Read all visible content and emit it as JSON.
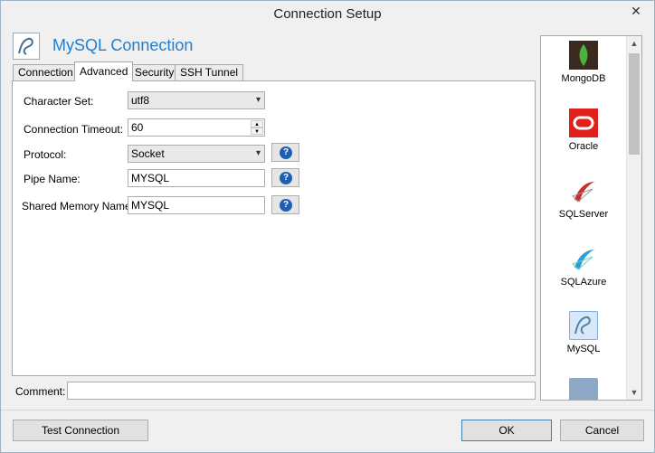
{
  "window": {
    "title": "Connection Setup",
    "close_glyph": "✕"
  },
  "header": {
    "title": "MySQL Connection",
    "logo_icon": "mysql-dolphin-icon"
  },
  "tabs": [
    {
      "label": "Connection",
      "active": false
    },
    {
      "label": "Advanced",
      "active": true
    },
    {
      "label": "Security",
      "active": false
    },
    {
      "label": "SSH Tunnel",
      "active": false
    }
  ],
  "advanced": {
    "charset_label": "Character Set:",
    "charset_value": "utf8",
    "timeout_label": "Connection Timeout:",
    "timeout_value": "60",
    "protocol_label": "Protocol:",
    "protocol_value": "Socket",
    "pipe_label": "Pipe Name:",
    "pipe_value": "MYSQL",
    "shm_label": "Shared Memory Name:",
    "shm_value": "MYSQL",
    "help_glyph": "?"
  },
  "comment": {
    "label": "Comment:",
    "value": ""
  },
  "sidebar": {
    "items": [
      {
        "label": "MongoDB",
        "icon": "mongodb-leaf-icon",
        "color": "#3b2a20"
      },
      {
        "label": "Oracle",
        "icon": "oracle-icon",
        "color": "#e0201b"
      },
      {
        "label": "SQLServer",
        "icon": "sqlserver-icon",
        "color": "#c9302c"
      },
      {
        "label": "SQLAzure",
        "icon": "sqlazure-icon",
        "color": "#2aa0d8"
      },
      {
        "label": "MySQL",
        "icon": "mysql-icon",
        "color": "#5580a8",
        "selected": true
      }
    ]
  },
  "buttons": {
    "test": "Test Connection",
    "ok": "OK",
    "cancel": "Cancel"
  }
}
